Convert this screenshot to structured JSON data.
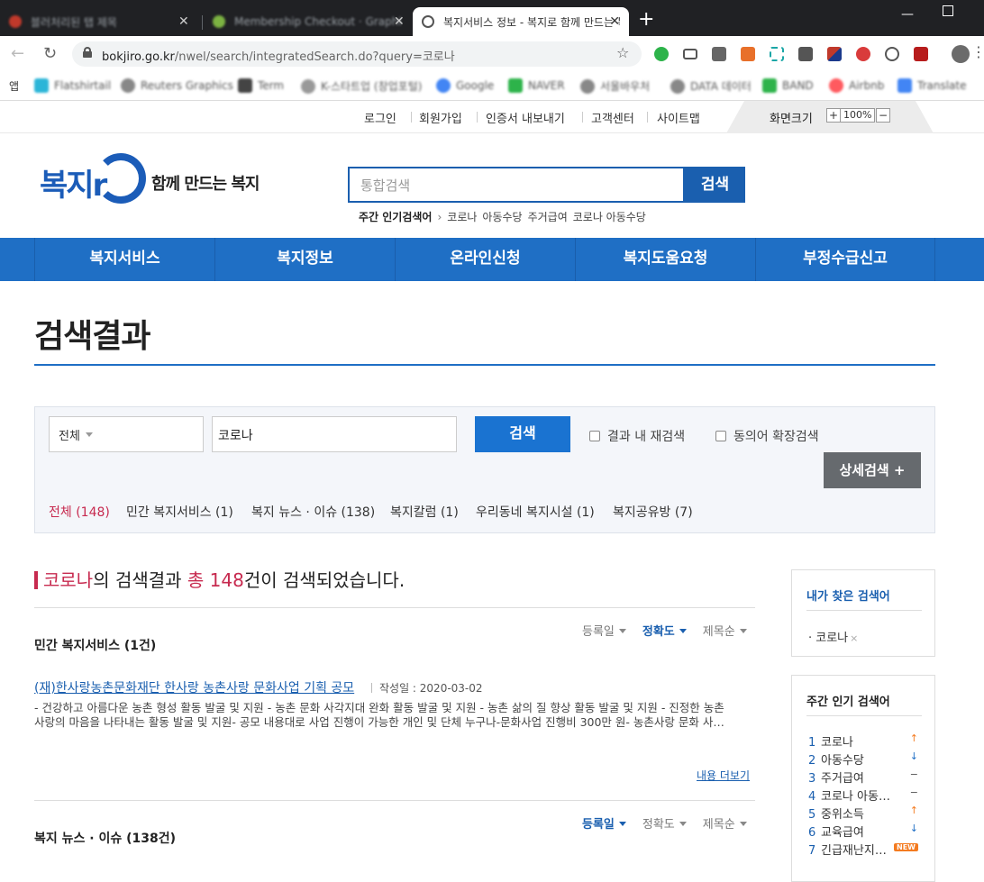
{
  "browser": {
    "tabs": [
      {
        "title": "블러처리된 탭 제목",
        "blurred": true
      },
      {
        "title": "Membership Checkout · Graphic",
        "blurred": true
      },
      {
        "title": "복지서비스 정보 - 복지로 함께 만드는 복지",
        "blurred": false
      }
    ],
    "new_tab": "+",
    "url_host": "bokjiro.go.kr",
    "url_path": "/nwel/search/integratedSearch.do?query=코로나",
    "apps_label": "앱",
    "bookmarks": [
      "Flatshirtail",
      "Reuters Graphics",
      "Term",
      "K-스타트업 (창업포털)",
      "Google",
      "NAVER",
      "서울바우처",
      "DATA 데이터",
      "BAND",
      "Airbnb",
      "Translate"
    ]
  },
  "util": {
    "links": [
      "로그인",
      "회원가입",
      "인증서 내보내기",
      "고객센터",
      "사이트맵"
    ],
    "zoom_label": "화면크기",
    "zoom_plus": "+",
    "zoom_value": "100%",
    "zoom_minus": "−"
  },
  "header": {
    "logo_text": "복지r",
    "tagline": "함께 만드는 복지",
    "search_placeholder": "통합검색",
    "search_button": "검색",
    "popular_label": "주간 인기검색어",
    "popular_terms": [
      "코로나",
      "아동수당",
      "주거급여",
      "코로나 아동수당"
    ]
  },
  "gnb": [
    "복지서비스",
    "복지정보",
    "온라인신청",
    "복지도움요청",
    "부정수급신고"
  ],
  "page_title": "검색결과",
  "filter": {
    "select_value": "전체",
    "query": "코로나",
    "search_button": "검색",
    "check_within": "결과 내 재검색",
    "check_synonym": "동의어 확장검색",
    "detail_button": "상세검색 +",
    "categories": [
      {
        "label": "전체 (148)",
        "active": true
      },
      {
        "label": "민간 복지서비스 (1)",
        "active": false
      },
      {
        "label": "복지 뉴스 · 이슈 (138)",
        "active": false
      },
      {
        "label": "복지칼럼 (1)",
        "active": false
      },
      {
        "label": "우리동네 복지시설 (1)",
        "active": false
      },
      {
        "label": "복지공유방 (7)",
        "active": false
      }
    ]
  },
  "summary": {
    "keyword": "코로나",
    "mid1": "의 검색결과 ",
    "total_label": "총 148",
    "tail": "건이 검색되었습니다."
  },
  "sections": [
    {
      "title": "민간 복지서비스 (1건)",
      "sorts": [
        {
          "label": "등록일",
          "active": false
        },
        {
          "label": "정확도",
          "active": true
        },
        {
          "label": "제목순",
          "active": false
        }
      ],
      "result": {
        "title": "(재)한사랑농촌문화재단 한사랑 농촌사랑 문화사업 기획 공모",
        "date": "작성일 : 2020-03-02",
        "desc_line1": "- 건강하고 아름다운 농촌 형성 활동 발굴 및 지원 - 농촌 문화 사각지대 완화 활동 발굴 및 지원 - 농촌 삶의 질 향상 활동 발굴 및 지원 - 진정한 농촌",
        "desc_line2": "사랑의 마음을 나타내는 활동 발굴 및 지원- 공모 내용대로 사업 진행이 가능한 개인 및 단체 누구나-문화사업 진행비 300만 원- 농촌사랑 문화 사…",
        "more": "내용 더보기"
      }
    },
    {
      "title": "복지 뉴스 · 이슈 (138건)",
      "sorts": [
        {
          "label": "등록일",
          "active": true
        },
        {
          "label": "정확도",
          "active": false
        },
        {
          "label": "제목순",
          "active": false
        }
      ]
    }
  ],
  "side": {
    "recent_title": "내가 찾은 검색어",
    "recent": [
      {
        "label": "코로나",
        "remove": "×"
      }
    ],
    "weekly_title": "주간 인기 검색어",
    "weekly": [
      {
        "rank": "1",
        "term": "코로나",
        "trend": "↑",
        "kind": "up"
      },
      {
        "rank": "2",
        "term": "아동수당",
        "trend": "↓",
        "kind": "down"
      },
      {
        "rank": "3",
        "term": "주거급여",
        "trend": "−",
        "kind": "same"
      },
      {
        "rank": "4",
        "term": "코로나 아동수당",
        "trend": "−",
        "kind": "same"
      },
      {
        "rank": "5",
        "term": "중위소득",
        "trend": "↑",
        "kind": "up"
      },
      {
        "rank": "6",
        "term": "교육급여",
        "trend": "↓",
        "kind": "down"
      },
      {
        "rank": "7",
        "term": "긴급재난지원금",
        "trend": "NEW",
        "kind": "new"
      }
    ]
  }
}
